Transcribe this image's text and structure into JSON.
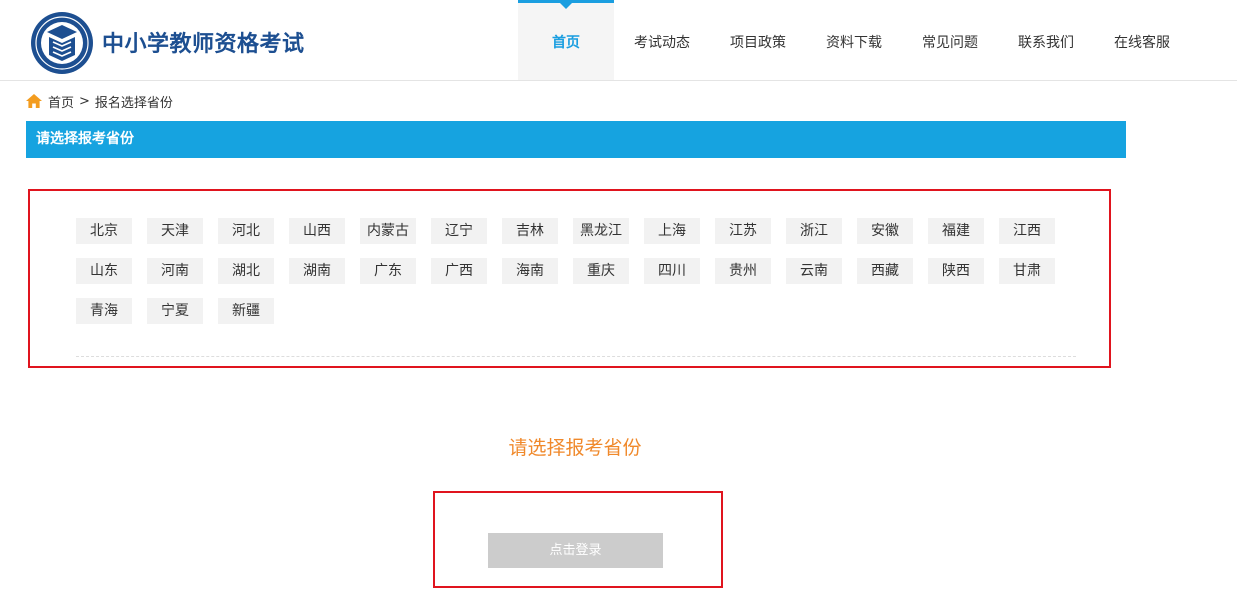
{
  "header": {
    "site_title": "中小学教师资格考试",
    "logo_icon": "ntce-seal-logo-icon",
    "brand_color": "#1d4f91"
  },
  "nav": {
    "accent_color": "#1a9ee0",
    "items": [
      {
        "label": "首页",
        "active": true
      },
      {
        "label": "考试动态",
        "active": false
      },
      {
        "label": "项目政策",
        "active": false
      },
      {
        "label": "资料下载",
        "active": false
      },
      {
        "label": "常见问题",
        "active": false
      },
      {
        "label": "联系我们",
        "active": false
      },
      {
        "label": "在线客服",
        "active": false
      }
    ]
  },
  "breadcrumb": {
    "home_icon": "home-icon",
    "home_label": "首页",
    "separator": ">",
    "current": "报名选择省份"
  },
  "section": {
    "title": "请选择报考省份",
    "bar_color": "#16a3e0"
  },
  "provinces": [
    "北京",
    "天津",
    "河北",
    "山西",
    "内蒙古",
    "辽宁",
    "吉林",
    "黑龙江",
    "上海",
    "江苏",
    "浙江",
    "安徽",
    "福建",
    "江西",
    "山东",
    "河南",
    "湖北",
    "湖南",
    "广东",
    "广西",
    "海南",
    "重庆",
    "四川",
    "贵州",
    "云南",
    "西藏",
    "陕西",
    "甘肃",
    "青海",
    "宁夏",
    "新疆"
  ],
  "prompt": {
    "text": "请选择报考省份",
    "color": "#f0892b"
  },
  "login": {
    "button_label": "点击登录",
    "disabled": true
  },
  "highlight_color": "#e0141e"
}
